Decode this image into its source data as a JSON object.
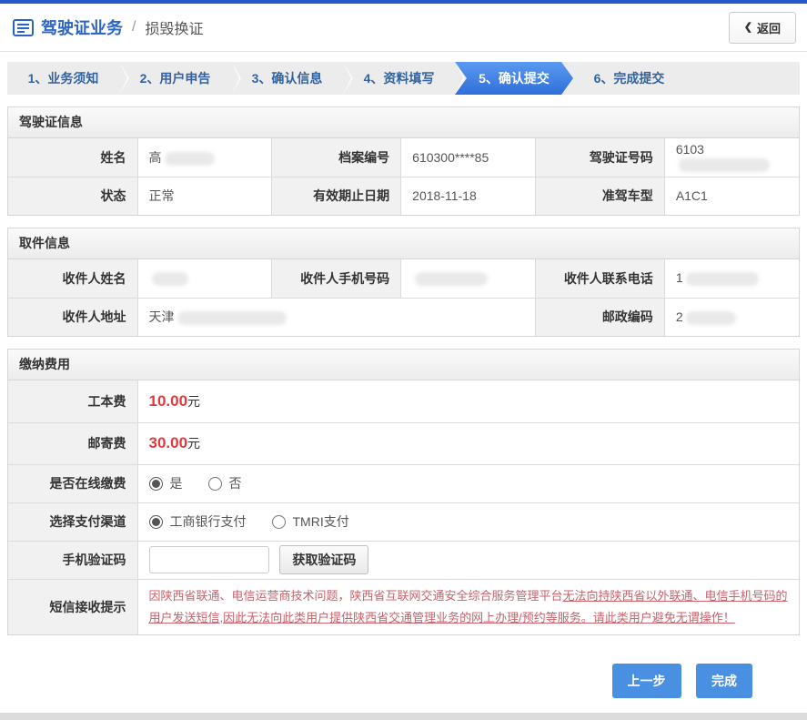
{
  "app": {
    "title": "驾驶证业务",
    "separator": "/",
    "subtitle": "损毁换证",
    "back_chevron": "❮",
    "back_label": "返回"
  },
  "steps": {
    "items": [
      {
        "label": "1、业务须知"
      },
      {
        "label": "2、用户申告"
      },
      {
        "label": "3、确认信息"
      },
      {
        "label": "4、资料填写"
      },
      {
        "label": "5、确认提交"
      },
      {
        "label": "6、完成提交"
      }
    ],
    "active_step": "5、确认提交",
    "active_color": "#2f6fd8"
  },
  "license_info": {
    "title": "驾驶证信息",
    "name_label": "姓名",
    "name_value_visible": "高",
    "file_no_label": "档案编号",
    "file_no_value": "610300****85",
    "license_no_label": "驾驶证号码",
    "license_no_value_visible": "6103",
    "status_label": "状态",
    "status_value": "正常",
    "expiry_label": "有效期止日期",
    "expiry_value": "2018-11-18",
    "vehicle_label": "准驾车型",
    "vehicle_value": "A1C1"
  },
  "pickup_info": {
    "title": "取件信息",
    "recipient_name_label": "收件人姓名",
    "mobile_label": "收件人手机号码",
    "phone_label": "收件人联系电话",
    "phone_value_visible": "1",
    "address_label": "收件人地址",
    "address_value_visible": "天津",
    "postcode_label": "邮政编码",
    "postcode_value_visible": "2"
  },
  "fees": {
    "title": "缴纳费用",
    "cost_label": "工本费",
    "cost_value": "10.00",
    "cost_unit": "元",
    "postage_label": "邮寄费",
    "postage_value": "30.00",
    "postage_unit": "元",
    "online_label": "是否在线缴费",
    "option_yes": "是",
    "option_no": "否",
    "online_selected": "是",
    "channel_label": "选择支付渠道",
    "channel_icbc": "工商银行支付",
    "channel_tmri": "TMRI支付",
    "channel_selected": "工商银行支付",
    "captcha_label": "手机验证码",
    "captcha_value": "",
    "captcha_button": "获取验证码",
    "notice_label": "短信接收提示",
    "notice_normal": "因陕西省联通、电信运营商技术问题，陕西省互联网交通安全综合服务管理平台",
    "notice_underlined": "无法向持陕西省以外联通、电信手机号码的用户发送短信,因此无法向此类用户提供陕西省交通管理业务的网上办理/预约等服务。请此类用户避免无谓操作！"
  },
  "footer": {
    "prev_label": "上一步",
    "done_label": "完成"
  },
  "colors": {
    "topbar": "#2457c5",
    "title_blue": "#2a64c5",
    "fee_red": "#e4393c",
    "notice_red": "#c8626b",
    "button_blue": "#4a90e2"
  }
}
